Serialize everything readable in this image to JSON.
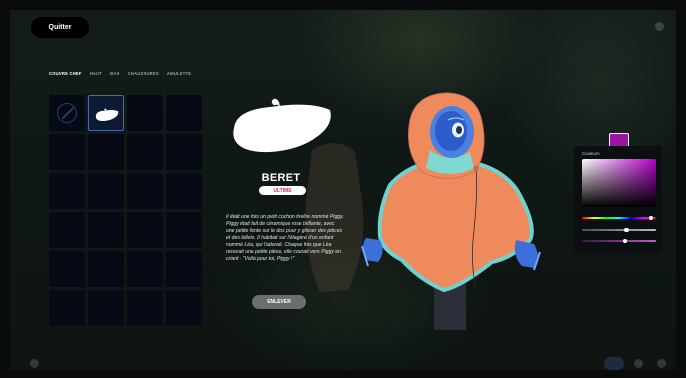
{
  "header": {
    "quit_label": "Quitter",
    "top_right": [
      "",
      ""
    ]
  },
  "tabs": [
    {
      "label": "COUVRE CHEF",
      "active": true
    },
    {
      "label": "HAUT",
      "active": false
    },
    {
      "label": "BAS",
      "active": false
    },
    {
      "label": "CHAUSSURES",
      "active": false
    },
    {
      "label": "AMULETTE",
      "active": false
    }
  ],
  "inventory": {
    "columns": 4,
    "rows": 6,
    "equipped_slot": 1,
    "none_slot": 0,
    "items": [
      "beret-icon"
    ]
  },
  "item": {
    "name": "BERET",
    "rarity": "ULTIME",
    "rarity_color": "#d42a5e",
    "description": "Il était une fois un petit cochon tirelire nommé Piggy. Piggy était fait de céramique rose brillante, avec une petite fente sur le dos pour y glisser des pièces et des billets. Il habitait sur l'étagère d'un enfant nommé Léa, qui l'adorait. Chaque fois que Léa recevait une petite pièce, elle courait vers Piggy en criant : \"Voilà pour toi, Piggy !\"",
    "remove_label": "ENLEVER"
  },
  "color_picker": {
    "label": "Couleurs",
    "selected_color": "#9a14a8",
    "hue": 0.93,
    "saturation": 0.6,
    "alpha": 0.58
  },
  "footer": {
    "left_label": "",
    "right_actions": [
      "",
      "",
      ""
    ]
  },
  "colors": {
    "accent": "#4c6aa8",
    "cape": "#f08a5d",
    "hood_trim": "#6ed0d0",
    "mask": "#2f6de0"
  }
}
